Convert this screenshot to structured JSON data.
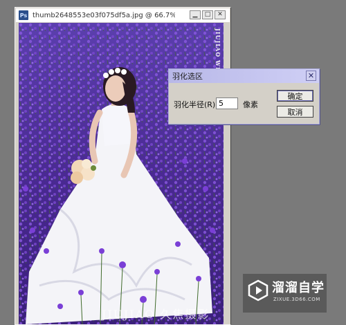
{
  "document": {
    "app_icon": "Ps",
    "title": "thumb2648553e03f075df5a.jpg @ 66.7%(...",
    "minimize_glyph": "▁",
    "maximize_glyph": "□",
    "close_glyph": "✕",
    "side_watermark": "JIUJIAO WEDDING",
    "bottom_watermark": "JIUJIAO 久焦摄影",
    "colors": {
      "flowers": "#6a3fbf",
      "dress": "#f4f4f8"
    }
  },
  "dialog": {
    "title": "羽化选区",
    "close_glyph": "✕",
    "radius_label": "羽化半径(R):",
    "radius_value": "5",
    "unit": "像素",
    "ok_label": "确定",
    "cancel_label": "取消"
  },
  "logo": {
    "name_cn": "溜溜自学",
    "url": "ZIXUE.3D66.COM",
    "icon": "play-icon"
  }
}
